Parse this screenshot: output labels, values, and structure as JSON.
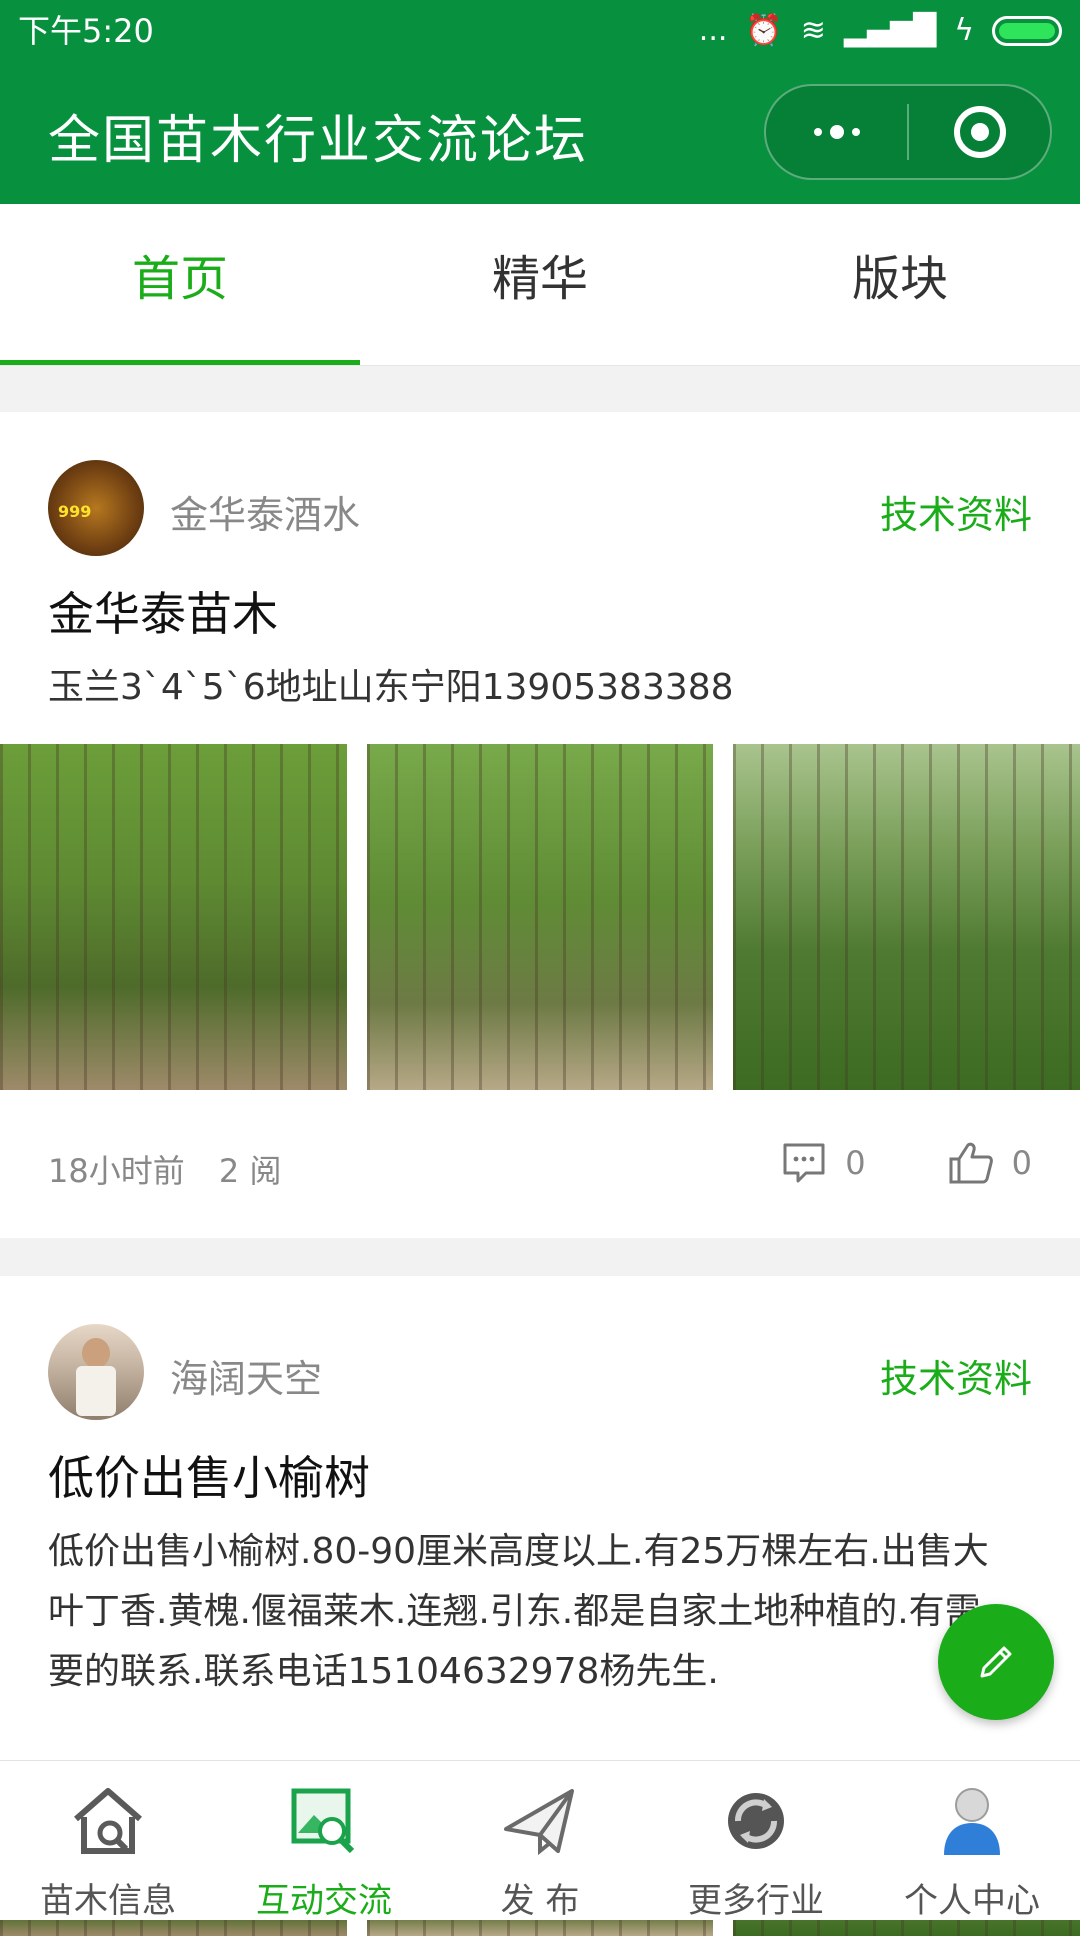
{
  "status_bar": {
    "time": "下午5:20",
    "dots": "...",
    "alarm": "⏰",
    "wifi": "≋",
    "signal": "▂▄▆█",
    "charging": "ϟ"
  },
  "app": {
    "title": "全国苗木行业交流论坛"
  },
  "tabs": [
    {
      "label": "首页",
      "active": true
    },
    {
      "label": "精华",
      "active": false
    },
    {
      "label": "版块",
      "active": false
    }
  ],
  "posts": [
    {
      "author": "金华泰酒水",
      "avatar_text": "999",
      "category": "技术资料",
      "title": "金华泰苗木",
      "body": "玉兰3`4`5`6地址山东宁阳13905383388",
      "time": "18小时前",
      "reads": "2 阅",
      "comments": "0",
      "likes": "0"
    },
    {
      "author": "海阔天空",
      "category": "技术资料",
      "title": "低价出售小榆树",
      "body": "低价出售小榆树.80-90厘米高度以上.有25万棵左右.出售大叶丁香.黄槐.偃福莱木.连翘.引东.都是自家土地种植的.有需要的联系.联系电话15104632978杨先生."
    }
  ],
  "bottom_nav": [
    {
      "label": "苗木信息",
      "icon": "house-search-icon"
    },
    {
      "label": "互动交流",
      "icon": "image-search-icon",
      "active": true
    },
    {
      "label": "发 布",
      "icon": "paper-plane-icon"
    },
    {
      "label": "更多行业",
      "icon": "recycle-icon"
    },
    {
      "label": "个人中心",
      "icon": "user-icon"
    }
  ],
  "colors": {
    "brand": "#07913f",
    "accent": "#1aad19"
  }
}
